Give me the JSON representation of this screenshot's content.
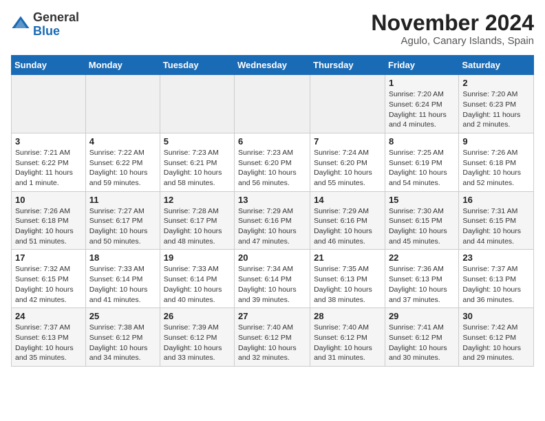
{
  "header": {
    "logo_general": "General",
    "logo_blue": "Blue",
    "title": "November 2024",
    "subtitle": "Agulo, Canary Islands, Spain"
  },
  "calendar": {
    "days_of_week": [
      "Sunday",
      "Monday",
      "Tuesday",
      "Wednesday",
      "Thursday",
      "Friday",
      "Saturday"
    ],
    "weeks": [
      [
        {
          "day": "",
          "info": ""
        },
        {
          "day": "",
          "info": ""
        },
        {
          "day": "",
          "info": ""
        },
        {
          "day": "",
          "info": ""
        },
        {
          "day": "",
          "info": ""
        },
        {
          "day": "1",
          "info": "Sunrise: 7:20 AM\nSunset: 6:24 PM\nDaylight: 11 hours and 4 minutes."
        },
        {
          "day": "2",
          "info": "Sunrise: 7:20 AM\nSunset: 6:23 PM\nDaylight: 11 hours and 2 minutes."
        }
      ],
      [
        {
          "day": "3",
          "info": "Sunrise: 7:21 AM\nSunset: 6:22 PM\nDaylight: 11 hours and 1 minute."
        },
        {
          "day": "4",
          "info": "Sunrise: 7:22 AM\nSunset: 6:22 PM\nDaylight: 10 hours and 59 minutes."
        },
        {
          "day": "5",
          "info": "Sunrise: 7:23 AM\nSunset: 6:21 PM\nDaylight: 10 hours and 58 minutes."
        },
        {
          "day": "6",
          "info": "Sunrise: 7:23 AM\nSunset: 6:20 PM\nDaylight: 10 hours and 56 minutes."
        },
        {
          "day": "7",
          "info": "Sunrise: 7:24 AM\nSunset: 6:20 PM\nDaylight: 10 hours and 55 minutes."
        },
        {
          "day": "8",
          "info": "Sunrise: 7:25 AM\nSunset: 6:19 PM\nDaylight: 10 hours and 54 minutes."
        },
        {
          "day": "9",
          "info": "Sunrise: 7:26 AM\nSunset: 6:18 PM\nDaylight: 10 hours and 52 minutes."
        }
      ],
      [
        {
          "day": "10",
          "info": "Sunrise: 7:26 AM\nSunset: 6:18 PM\nDaylight: 10 hours and 51 minutes."
        },
        {
          "day": "11",
          "info": "Sunrise: 7:27 AM\nSunset: 6:17 PM\nDaylight: 10 hours and 50 minutes."
        },
        {
          "day": "12",
          "info": "Sunrise: 7:28 AM\nSunset: 6:17 PM\nDaylight: 10 hours and 48 minutes."
        },
        {
          "day": "13",
          "info": "Sunrise: 7:29 AM\nSunset: 6:16 PM\nDaylight: 10 hours and 47 minutes."
        },
        {
          "day": "14",
          "info": "Sunrise: 7:29 AM\nSunset: 6:16 PM\nDaylight: 10 hours and 46 minutes."
        },
        {
          "day": "15",
          "info": "Sunrise: 7:30 AM\nSunset: 6:15 PM\nDaylight: 10 hours and 45 minutes."
        },
        {
          "day": "16",
          "info": "Sunrise: 7:31 AM\nSunset: 6:15 PM\nDaylight: 10 hours and 44 minutes."
        }
      ],
      [
        {
          "day": "17",
          "info": "Sunrise: 7:32 AM\nSunset: 6:15 PM\nDaylight: 10 hours and 42 minutes."
        },
        {
          "day": "18",
          "info": "Sunrise: 7:33 AM\nSunset: 6:14 PM\nDaylight: 10 hours and 41 minutes."
        },
        {
          "day": "19",
          "info": "Sunrise: 7:33 AM\nSunset: 6:14 PM\nDaylight: 10 hours and 40 minutes."
        },
        {
          "day": "20",
          "info": "Sunrise: 7:34 AM\nSunset: 6:14 PM\nDaylight: 10 hours and 39 minutes."
        },
        {
          "day": "21",
          "info": "Sunrise: 7:35 AM\nSunset: 6:13 PM\nDaylight: 10 hours and 38 minutes."
        },
        {
          "day": "22",
          "info": "Sunrise: 7:36 AM\nSunset: 6:13 PM\nDaylight: 10 hours and 37 minutes."
        },
        {
          "day": "23",
          "info": "Sunrise: 7:37 AM\nSunset: 6:13 PM\nDaylight: 10 hours and 36 minutes."
        }
      ],
      [
        {
          "day": "24",
          "info": "Sunrise: 7:37 AM\nSunset: 6:13 PM\nDaylight: 10 hours and 35 minutes."
        },
        {
          "day": "25",
          "info": "Sunrise: 7:38 AM\nSunset: 6:12 PM\nDaylight: 10 hours and 34 minutes."
        },
        {
          "day": "26",
          "info": "Sunrise: 7:39 AM\nSunset: 6:12 PM\nDaylight: 10 hours and 33 minutes."
        },
        {
          "day": "27",
          "info": "Sunrise: 7:40 AM\nSunset: 6:12 PM\nDaylight: 10 hours and 32 minutes."
        },
        {
          "day": "28",
          "info": "Sunrise: 7:40 AM\nSunset: 6:12 PM\nDaylight: 10 hours and 31 minutes."
        },
        {
          "day": "29",
          "info": "Sunrise: 7:41 AM\nSunset: 6:12 PM\nDaylight: 10 hours and 30 minutes."
        },
        {
          "day": "30",
          "info": "Sunrise: 7:42 AM\nSunset: 6:12 PM\nDaylight: 10 hours and 29 minutes."
        }
      ]
    ]
  }
}
